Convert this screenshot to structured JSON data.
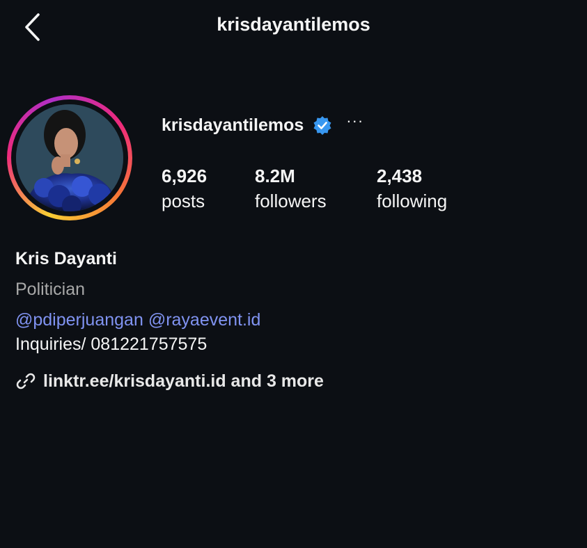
{
  "header": {
    "title": "krisdayantilemos",
    "back_icon": "chevron-left-icon"
  },
  "profile": {
    "username": "krisdayantilemos",
    "verified_icon": "verified-badge-icon",
    "verified_color": "#3897f0",
    "more_label": "···",
    "avatar_ring_colors": [
      "#f9ce34",
      "#ee2a7b",
      "#b02fc7",
      "#f77737"
    ],
    "stats": {
      "posts": {
        "value": "6,926",
        "label": "posts"
      },
      "followers": {
        "value": "8.2M",
        "label": "followers"
      },
      "following": {
        "value": "2,438",
        "label": "following"
      }
    }
  },
  "bio": {
    "name": "Kris Dayanti",
    "category": "Politician",
    "mentions": [
      "@pdiperjuangan",
      "@rayaevent.id"
    ],
    "inquiries": "Inquiries/ 081221757575",
    "link_icon": "link-icon",
    "link_text": "linktr.ee/krisdayanti.id and 3 more"
  },
  "colors": {
    "background": "#0c0f14",
    "text": "#f5f5f5",
    "secondary_text": "#a8a8a8",
    "mention": "#8093f1"
  }
}
